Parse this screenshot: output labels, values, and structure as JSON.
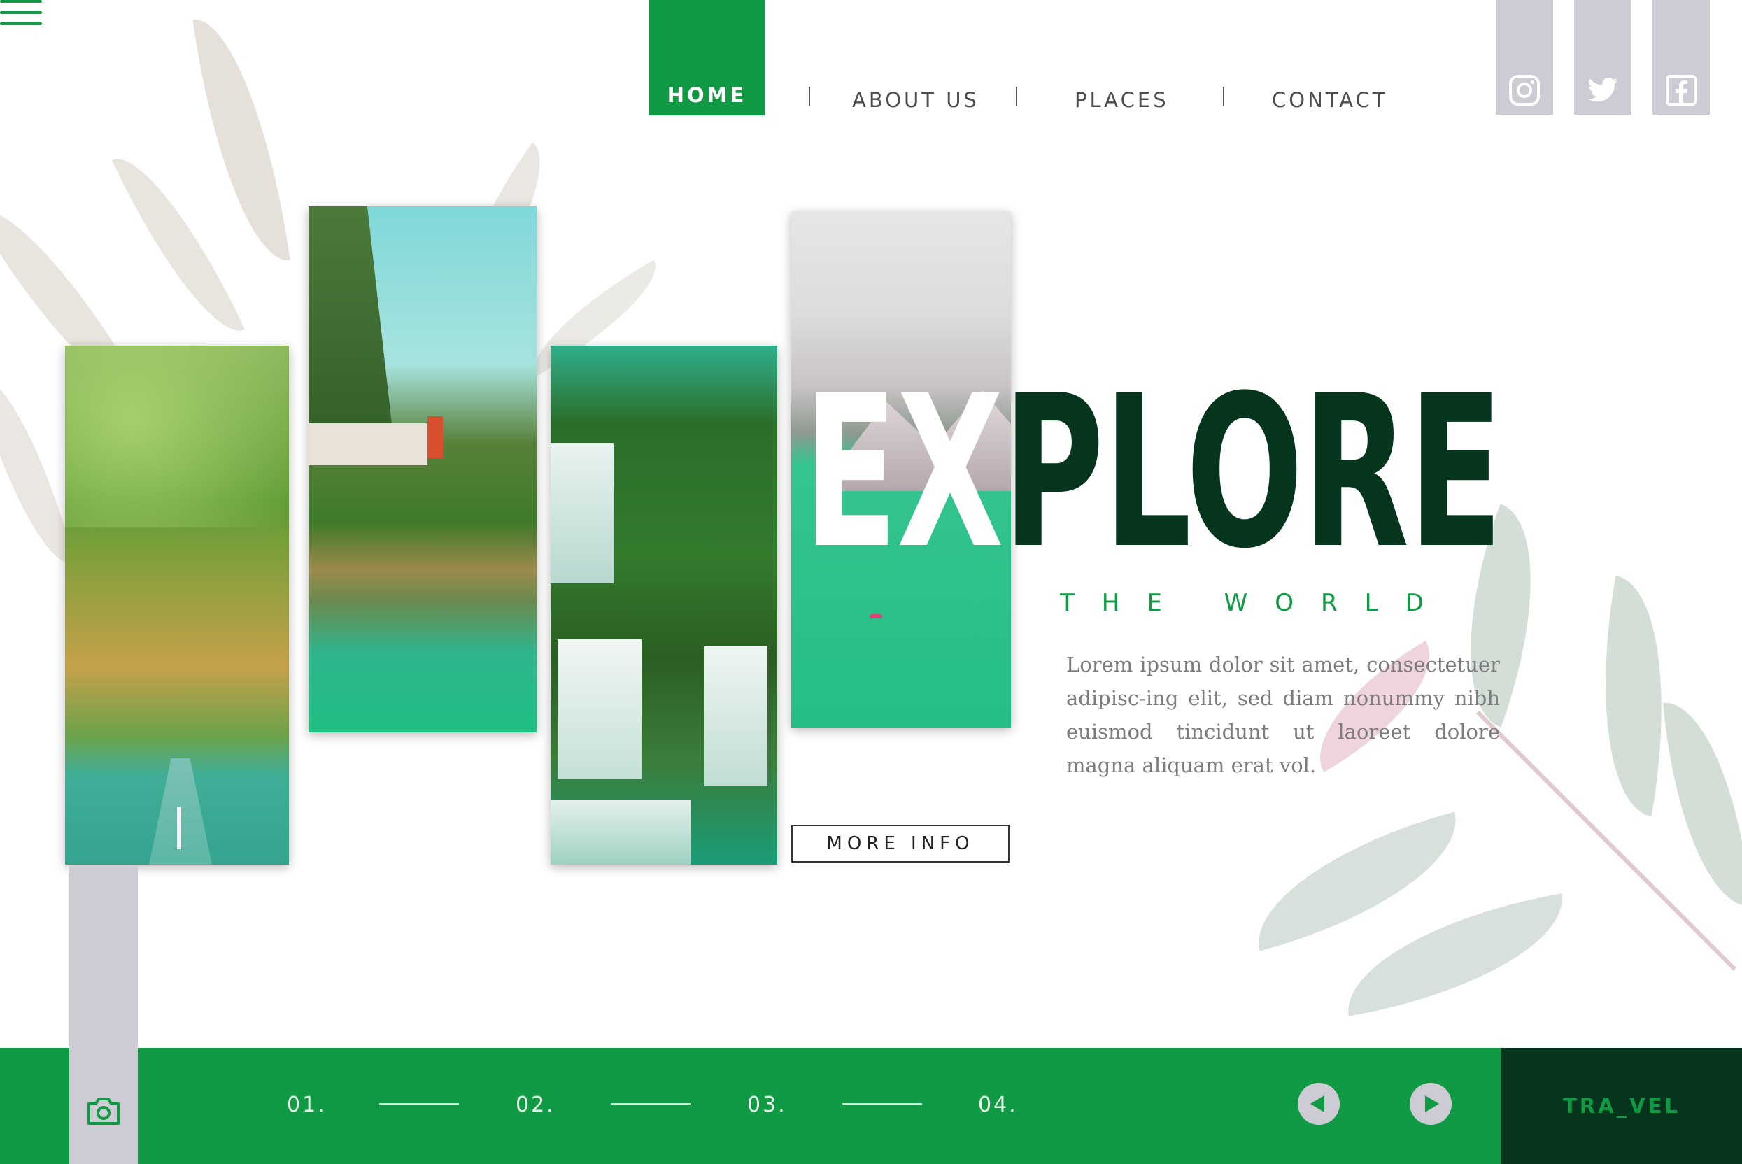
{
  "nav": {
    "items": [
      {
        "label": "HOME",
        "active": true
      },
      {
        "label": "ABOUT US"
      },
      {
        "label": "PLACES"
      },
      {
        "label": "CONTACT"
      }
    ]
  },
  "social": [
    "instagram-icon",
    "twitter-icon",
    "facebook-icon"
  ],
  "hero": {
    "title_part1": "EX",
    "title_part2": "PLORE",
    "subtitle": "THE WORLD",
    "description": "Lorem ipsum dolor sit amet, consectetuer adipisc-ing elit, sed diam nonummy nibh euismod tincidunt ut laoreet dolore magna aliquam erat vol.",
    "button": "MORE INFO"
  },
  "footer": {
    "steps": [
      "01.",
      "02.",
      "03.",
      "04."
    ],
    "brand": "TRA_VEL"
  },
  "colors": {
    "primary_green": "#0f9a43",
    "dark_green": "#06351e",
    "lavender_gray": "#cdcbd3"
  }
}
